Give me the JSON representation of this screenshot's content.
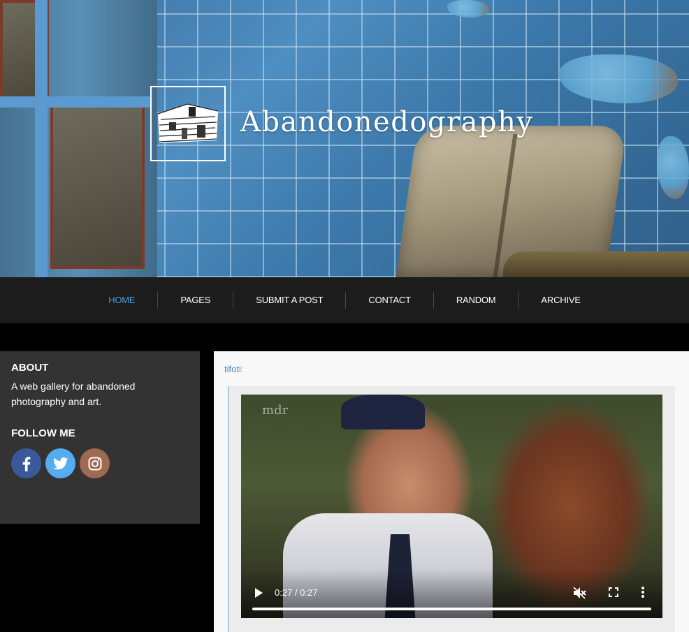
{
  "header": {
    "site_title": "Abandonedography"
  },
  "nav": {
    "items": [
      {
        "label": "HOME",
        "active": true
      },
      {
        "label": "PAGES"
      },
      {
        "label": "SUBMIT A POST"
      },
      {
        "label": "CONTACT"
      },
      {
        "label": "RANDOM"
      },
      {
        "label": "ARCHIVE"
      }
    ]
  },
  "sidebar": {
    "about_heading": "ABOUT",
    "about_text": "A web gallery for abandoned photography and art.",
    "follow_heading": "FOLLOW ME",
    "social": [
      {
        "icon": "facebook-icon",
        "color": "#3b5998"
      },
      {
        "icon": "twitter-icon",
        "color": "#55acee"
      },
      {
        "icon": "instagram-icon",
        "color": "#a06a52"
      }
    ]
  },
  "post": {
    "author": "tifoti:",
    "video": {
      "watermark": "mdr",
      "time": "0:27 / 0:27",
      "progress": 1.0
    }
  },
  "colors": {
    "accent": "#4a9ad8",
    "nav_bg": "#1c1c1c",
    "sidebar_bg": "#333333"
  }
}
